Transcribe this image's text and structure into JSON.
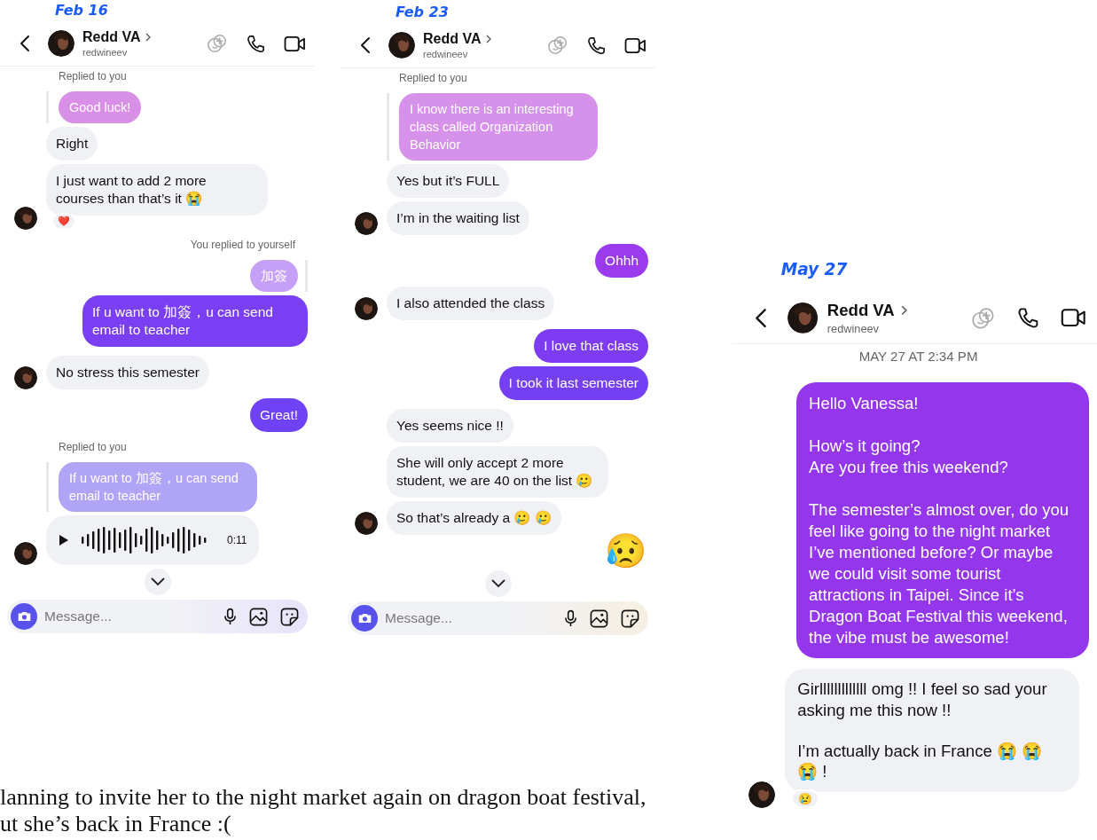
{
  "panels": [
    {
      "note": "Feb 16",
      "contact": {
        "name": "Redd VA",
        "username": "redwineev"
      },
      "scroll_down": true,
      "composer": {
        "placeholder": "Message..."
      },
      "messages": [
        {
          "kind": "reply_label",
          "outgoing": false,
          "text": "Replied to you"
        },
        {
          "kind": "quote",
          "outgoing": false,
          "text": "Good luck!",
          "color": "#d68be6"
        },
        {
          "kind": "text",
          "outgoing": false,
          "text": "Right",
          "avatar": false
        },
        {
          "kind": "text",
          "outgoing": false,
          "text": "I just want to add 2 more courses than that’s it 😭",
          "avatar": true,
          "reaction": "❤️"
        },
        {
          "kind": "reply_label",
          "outgoing": true,
          "text": "You replied to yourself"
        },
        {
          "kind": "quote",
          "outgoing": true,
          "text": "加簽",
          "color": "#c49af6"
        },
        {
          "kind": "text",
          "outgoing": true,
          "text": "If u want to 加簽，u can send email to teacher",
          "color": "#7a3ff2"
        },
        {
          "kind": "text",
          "outgoing": false,
          "text": "No stress this semester",
          "avatar": true
        },
        {
          "kind": "text",
          "outgoing": true,
          "text": "Great!",
          "color": "#6f42f5"
        },
        {
          "kind": "reply_label",
          "outgoing": false,
          "text": "Replied to you"
        },
        {
          "kind": "quote",
          "outgoing": false,
          "text": "If u want to 加簽，u can send email to teacher",
          "color": "#aca0f6"
        },
        {
          "kind": "voice",
          "outgoing": false,
          "duration": "0:11",
          "avatar": true
        }
      ]
    },
    {
      "note": "Feb 23",
      "contact": {
        "name": "Redd VA",
        "username": "redwineev"
      },
      "scroll_down": true,
      "composer": {
        "placeholder": "Message..."
      },
      "messages": [
        {
          "kind": "reply_label",
          "outgoing": false,
          "text": "Replied to you"
        },
        {
          "kind": "quote",
          "outgoing": false,
          "text": "I know there is an interesting class called Organization Behavior",
          "color": "#d48de9"
        },
        {
          "kind": "text",
          "outgoing": false,
          "text": "Yes but it’s FULL",
          "avatar": false
        },
        {
          "kind": "text",
          "outgoing": false,
          "text": "I’m in the waiting list",
          "avatar": true
        },
        {
          "kind": "text",
          "outgoing": true,
          "text": "Ohhh",
          "color": "#9a3bef"
        },
        {
          "kind": "text",
          "outgoing": false,
          "text": "I also attended the class",
          "avatar": true
        },
        {
          "kind": "text",
          "outgoing": true,
          "text": "I love that class",
          "color": "#7d3cf2"
        },
        {
          "kind": "text",
          "outgoing": true,
          "text": "I took it last semester",
          "color": "#7540f4"
        },
        {
          "kind": "text",
          "outgoing": false,
          "text": "Yes seems nice !!",
          "avatar": false
        },
        {
          "kind": "text",
          "outgoing": false,
          "text": "She will only accept 2 more student, we are 40 on the list 🥲",
          "avatar": false
        },
        {
          "kind": "text",
          "outgoing": false,
          "text": "So that’s already a 🥲 🥲",
          "avatar": true
        },
        {
          "kind": "emoji",
          "outgoing": true,
          "text": "😥"
        }
      ]
    },
    {
      "note": "May 27",
      "contact": {
        "name": "Redd VA",
        "username": "redwineev"
      },
      "messages": [
        {
          "kind": "timestamp",
          "text": "MAY 27 AT 2:34 PM"
        },
        {
          "kind": "text",
          "outgoing": true,
          "text": "Hello Vanessa!\n\nHow’s it going?\nAre you free this weekend?\n\nThe semester’s almost over, do you feel like going to the night market I’ve mentioned before? Or maybe we could visit some tourist attractions in Taipei. Since it’s Dragon Boat Festival this weekend, the vibe must be awesome!",
          "color": "#9437ec"
        },
        {
          "kind": "text",
          "outgoing": false,
          "text": "Girlllllllllllll omg !! I feel so sad your asking me this now !!\n\nI’m actually back in France 😭 😭 😭 !",
          "avatar": true,
          "reaction": "😢"
        }
      ]
    }
  ],
  "caption": [
    "lanning to invite her to the night market again on dragon boat festival,",
    "ut she’s back in France :("
  ]
}
